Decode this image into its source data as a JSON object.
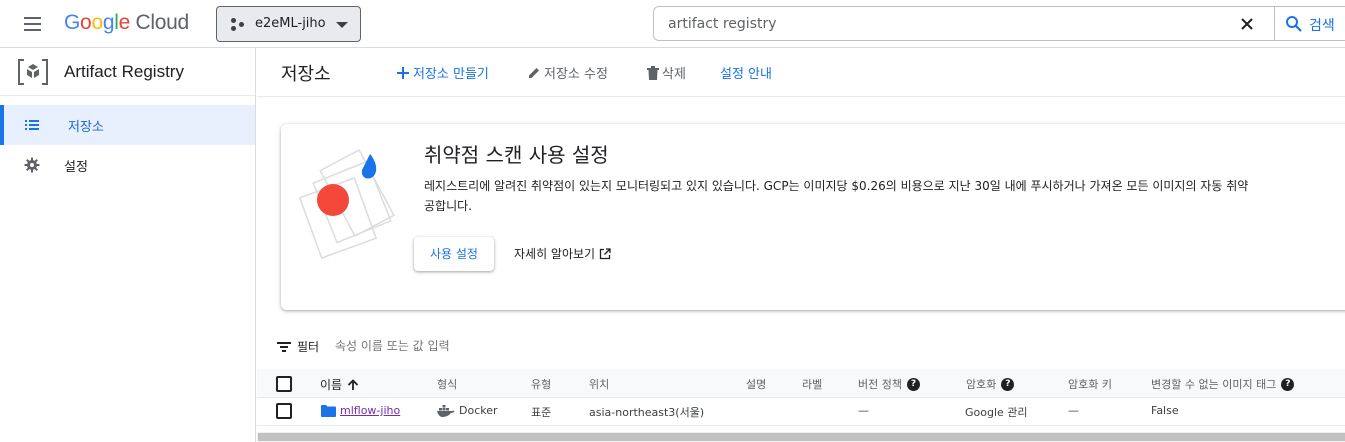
{
  "topbar": {
    "logo_google": "Google",
    "logo_cloud": "Cloud",
    "project_name": "e2eML-jiho",
    "search_value": "artifact registry",
    "search_button": "검색"
  },
  "sidebar": {
    "product_title": "Artifact Registry",
    "items": [
      {
        "label": "저장소",
        "active": true
      },
      {
        "label": "설정",
        "active": false
      }
    ]
  },
  "toolbar": {
    "title": "저장소",
    "create": "저장소 만들기",
    "edit": "저장소 수정",
    "delete": "삭제",
    "setup_guide": "설정 안내"
  },
  "scan_card": {
    "title": "취약점 스캔 사용 설정",
    "body_line1": "레지스트리에 알려진 취약점이 있는지 모니터링되고 있지 있습니다. GCP는 이미지당 $0.26의 비용으로 지난 30일 내에 푸시하거나 가져온 모든 이미지의 자동 취약",
    "body_line2": "공합니다.",
    "enable_button": "사용 설정",
    "learn_more": "자세히 알아보기"
  },
  "filter": {
    "label": "필터",
    "placeholder": "속성 이름 또는 값 입력"
  },
  "table": {
    "columns": {
      "name": "이름",
      "format": "형식",
      "mode": "유형",
      "location": "위치",
      "description": "설명",
      "labels": "라벨",
      "version_policy": "버전 정책",
      "encryption": "암호화",
      "encryption_key": "암호화 키",
      "immutable_tags": "변경할 수 없는 이미지 태그"
    },
    "rows": [
      {
        "name": "mlflow-jiho",
        "format": "Docker",
        "mode": "표준",
        "location": "asia-northeast3(서울)",
        "description": "",
        "labels": "",
        "version_policy": "—",
        "encryption": "Google 관리",
        "encryption_key": "—",
        "immutable_tags": "False"
      }
    ]
  },
  "colors": {
    "accent": "#1a73e8",
    "active_bg": "#e8f0fe",
    "link_visited": "#7b2aa8",
    "art_red": "#f4483b",
    "art_blue": "#1a73e8"
  }
}
